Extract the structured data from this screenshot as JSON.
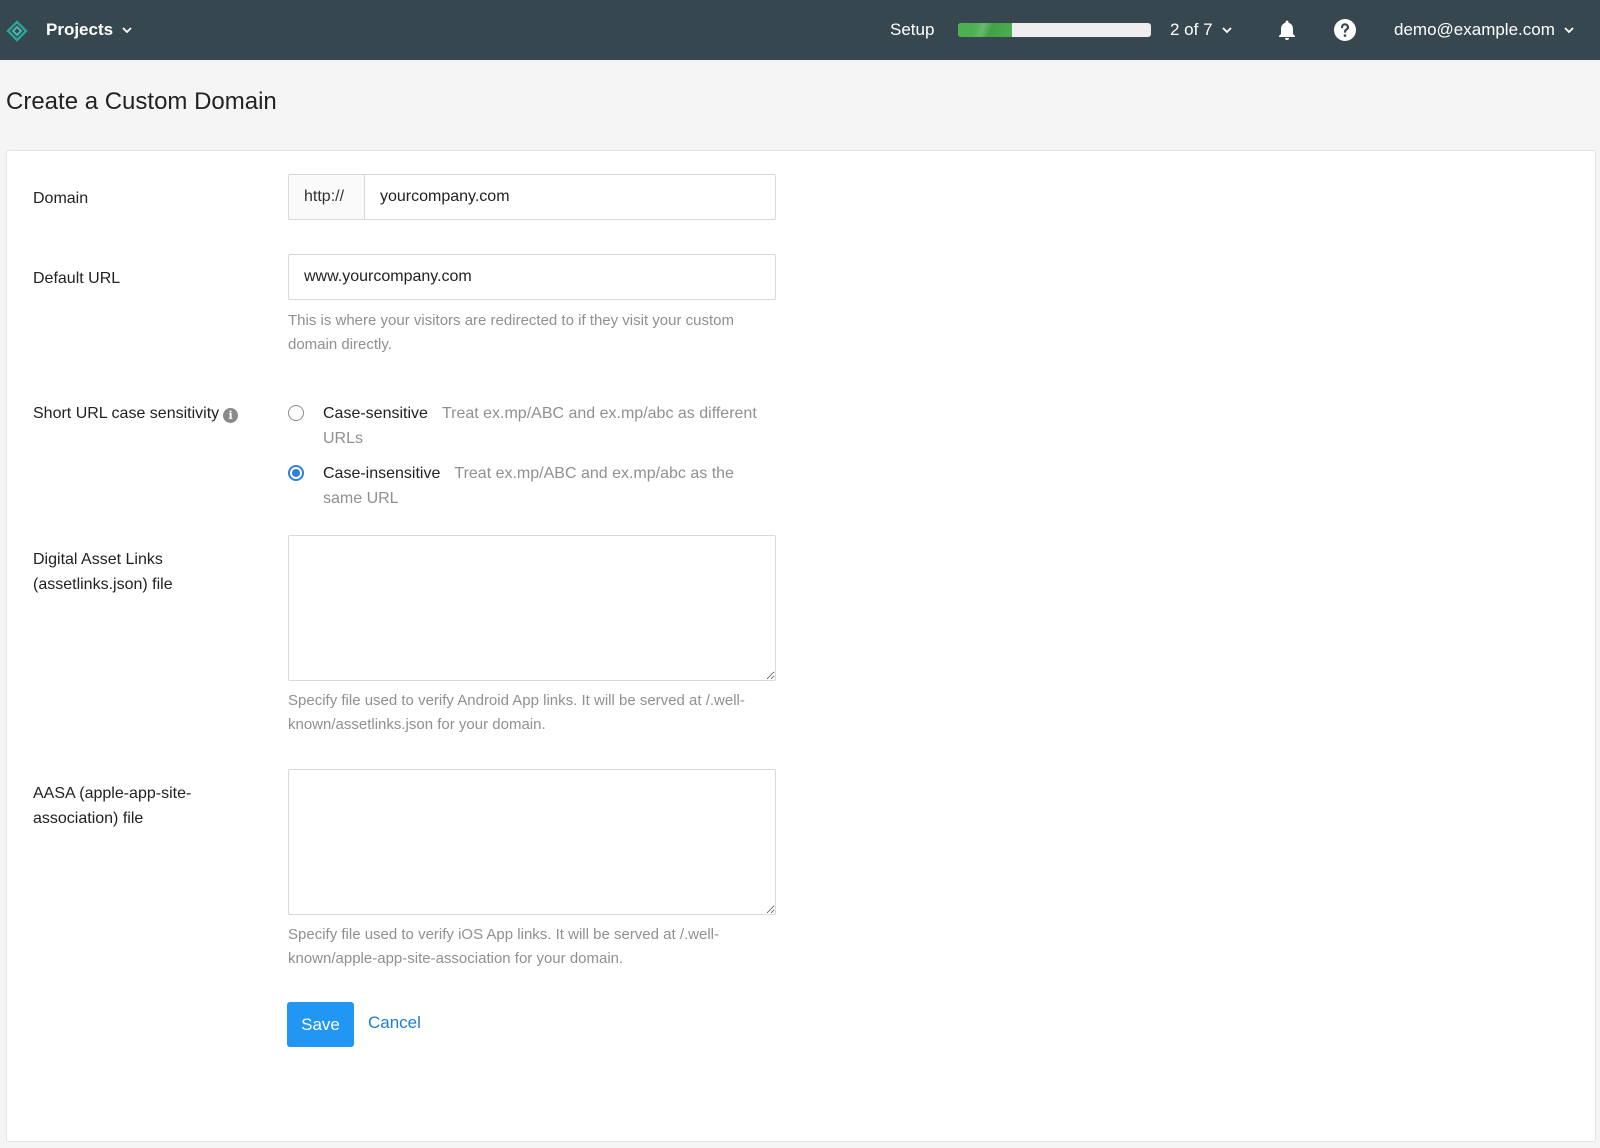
{
  "topbar": {
    "projects_label": "Projects",
    "setup_label": "Setup",
    "setup_progress": 0.28,
    "step_count": "2 of 7",
    "user_email": "demo@example.com",
    "colors": {
      "bar": "#37474f",
      "progress": "#4caf50",
      "logo": "#26a69a"
    }
  },
  "page": {
    "title": "Create a Custom Domain"
  },
  "form": {
    "domain": {
      "label": "Domain",
      "protocol": "http://",
      "value": "yourcompany.com"
    },
    "default_url": {
      "label": "Default URL",
      "value": "www.yourcompany.com",
      "help": "This is where your visitors are redirected to if they visit your custom domain directly."
    },
    "case_sensitivity": {
      "label": "Short URL case sensitivity",
      "info_icon": "info-icon",
      "options": [
        {
          "title": "Case-sensitive",
          "description": "Treat ex.mp/ABC and ex.mp/abc as different URLs",
          "checked": false
        },
        {
          "title": "Case-insensitive",
          "description": "Treat ex.mp/ABC and ex.mp/abc as the same URL",
          "checked": true
        }
      ]
    },
    "assetlinks": {
      "label": "Digital Asset Links (assetlinks.json) file",
      "value": "",
      "help": "Specify file used to verify Android App links. It will be served at /.well-known/assetlinks.json for your domain."
    },
    "aasa": {
      "label": "AASA (apple-app-site-association) file",
      "value": "",
      "help": "Specify file used to verify iOS App links. It will be served at /.well-known/apple-app-site-association for your domain."
    },
    "save_label": "Save",
    "cancel_label": "Cancel",
    "accent_color": "#2196f3"
  }
}
